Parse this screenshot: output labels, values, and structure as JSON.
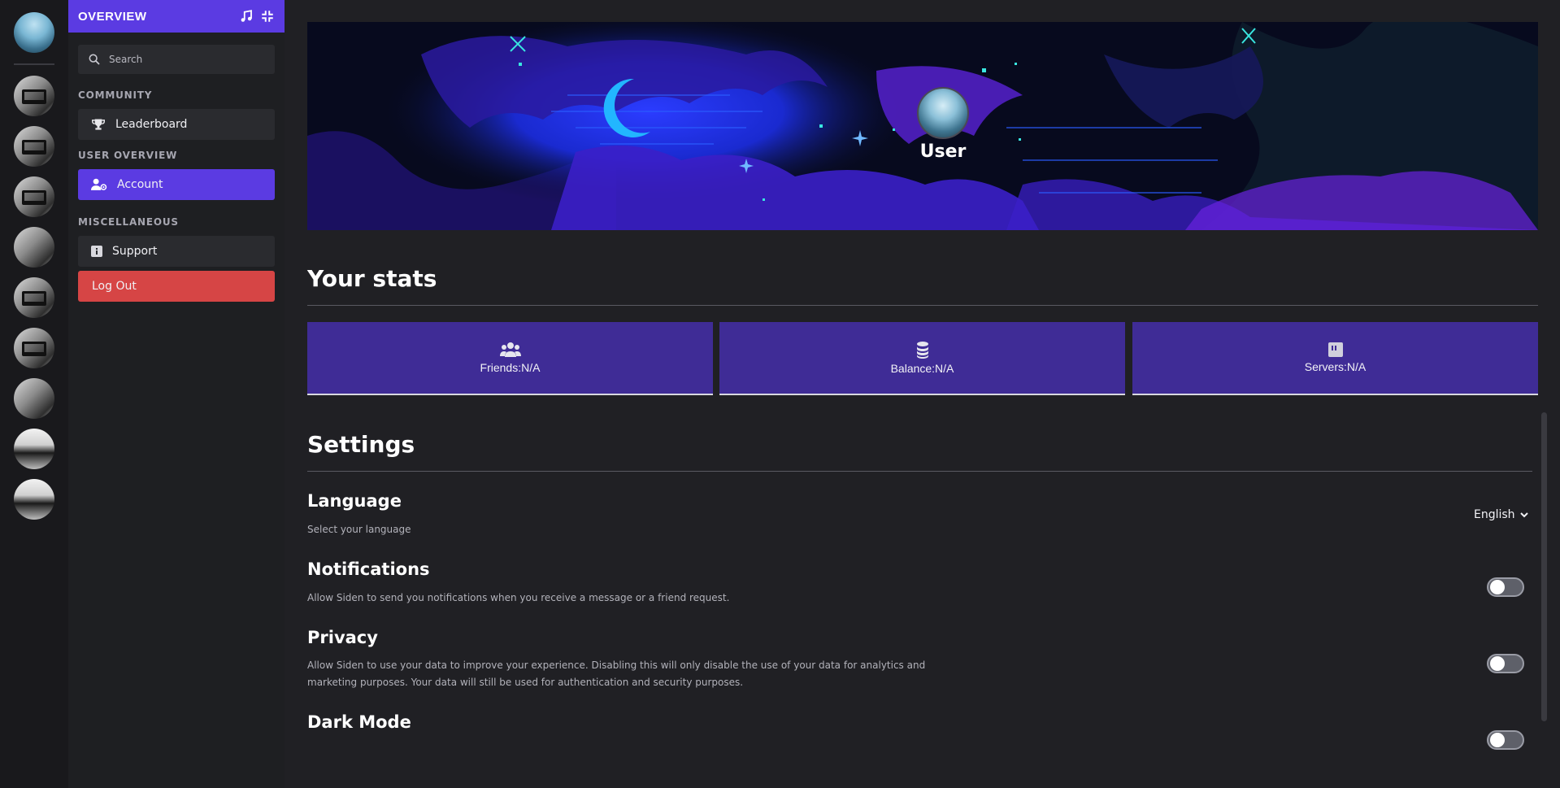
{
  "sidebar": {
    "header_title": "OVERVIEW",
    "search_placeholder": "Search",
    "sections": {
      "community": "COMMUNITY",
      "user_overview": "USER OVERVIEW",
      "miscellaneous": "MISCELLANEOUS"
    },
    "items": {
      "leaderboard": "Leaderboard",
      "account": "Account",
      "support": "Support",
      "logout": "Log Out"
    }
  },
  "profile": {
    "username": "User"
  },
  "stats": {
    "heading": "Your stats",
    "friends": "Friends:N/A",
    "balance": "Balance:N/A",
    "servers": "Servers:N/A"
  },
  "settings": {
    "heading": "Settings",
    "language": {
      "title": "Language",
      "desc": "Select your language",
      "value": "English"
    },
    "notifications": {
      "title": "Notifications",
      "desc": "Allow Siden to send you notifications when you receive a message or a friend request.",
      "enabled": false
    },
    "privacy": {
      "title": "Privacy",
      "desc": "Allow Siden to use your data to improve your experience. Disabling this will only disable the use of your data for analytics and marketing purposes. Your data will still be used for authentication and security purposes.",
      "enabled": false
    },
    "dark_mode": {
      "title": "Dark Mode",
      "enabled": false
    }
  },
  "colors": {
    "accent": "#5b3be2",
    "stat_card": "#3f2c96",
    "logout": "#d64545",
    "background": "#202024"
  }
}
